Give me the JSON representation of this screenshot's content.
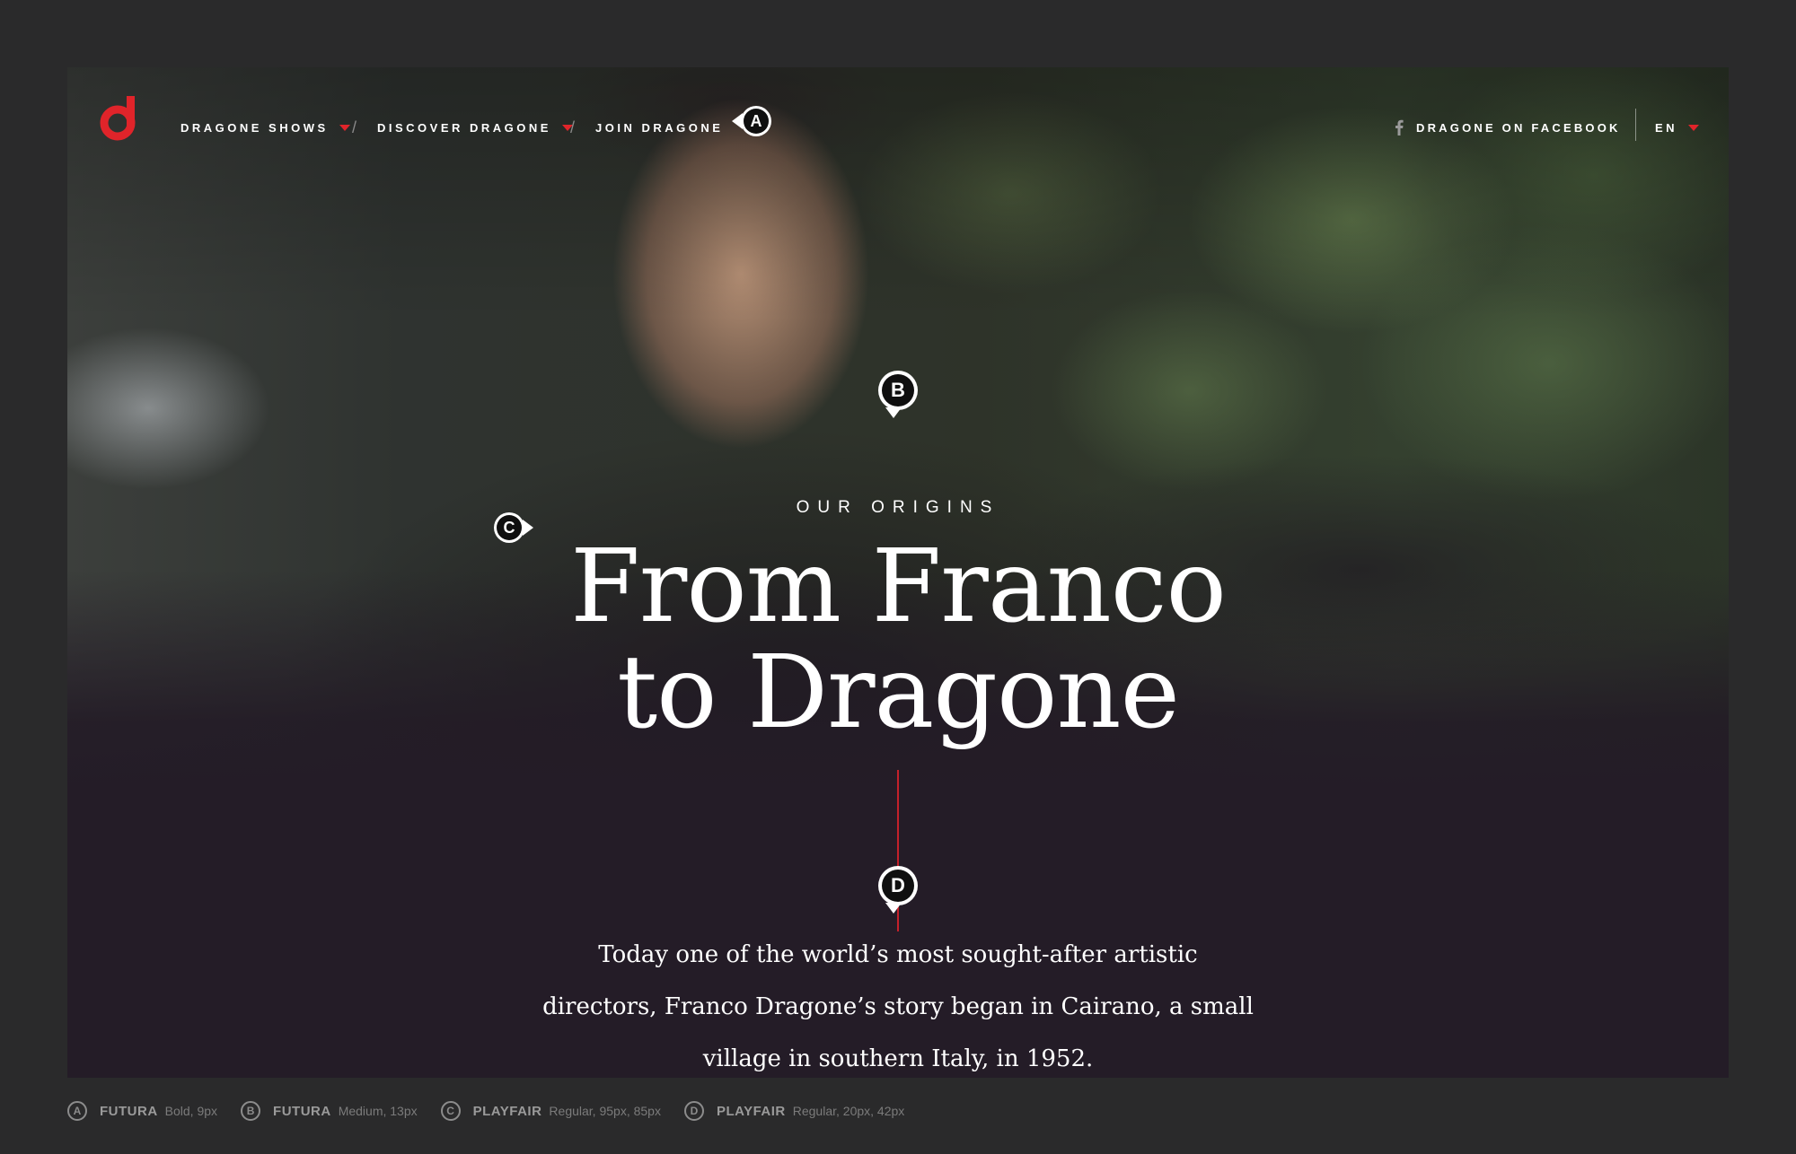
{
  "nav": {
    "items": [
      {
        "label": "DRAGONE SHOWS",
        "has_dropdown": true
      },
      {
        "label": "DISCOVER DRAGONE",
        "has_dropdown": true
      },
      {
        "label": "JOIN DRAGONE",
        "has_dropdown": false
      }
    ],
    "separator": "/",
    "facebook_label": "DRAGONE ON FACEBOOK",
    "language": "EN"
  },
  "hero": {
    "eyebrow": "OUR ORIGINS",
    "headline_line1": "From Franco",
    "headline_line2": "to Dragone",
    "body_line1": "Today one of the world’s most sought-after artistic",
    "body_line2": "directors, Franco Dragone’s story began in Cairano, a small",
    "body_line3": "village in southern Italy, in 1952."
  },
  "markers": {
    "a": "A",
    "b": "B",
    "c": "C",
    "d": "D"
  },
  "legend": [
    {
      "badge": "A",
      "font": "FUTURA",
      "spec": "Bold, 9px"
    },
    {
      "badge": "B",
      "font": "FUTURA",
      "spec": "Medium, 13px"
    },
    {
      "badge": "C",
      "font": "PLAYFAIR",
      "spec": "Regular, 95px, 85px"
    },
    {
      "badge": "D",
      "font": "PLAYFAIR",
      "spec": "Regular, 20px, 42px"
    }
  ],
  "colors": {
    "accent": "#e0242a",
    "frame_bg": "#2a2a2b",
    "hero_bg": "#241c27"
  },
  "icons": [
    "dragone-logo-icon",
    "facebook-icon",
    "dropdown-caret-icon"
  ]
}
